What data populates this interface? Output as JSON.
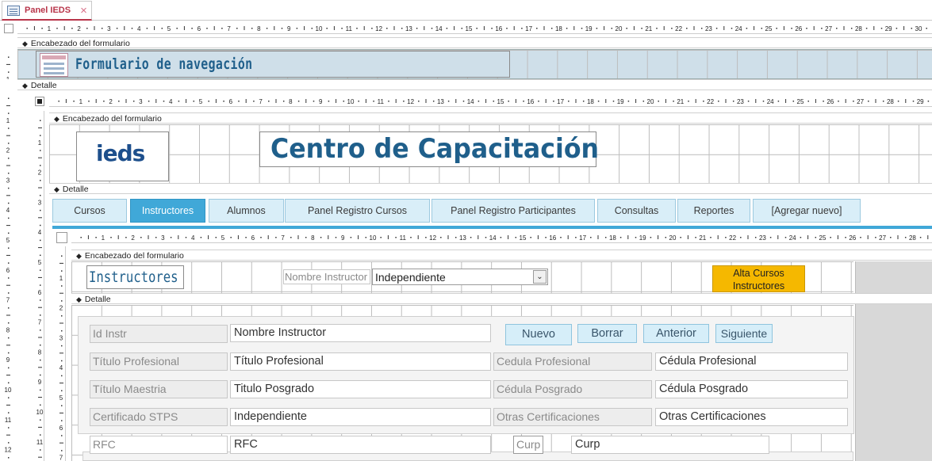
{
  "tab": {
    "title": "Panel IEDS",
    "close": "×"
  },
  "outer": {
    "header_section": "Encabezado del formulario",
    "title": "Formulario de navegación",
    "detail_section": "Detalle"
  },
  "nav_form": {
    "header_section": "Encabezado del formulario",
    "logo_text": "ieds",
    "title": "Centro de Capacitación",
    "detail_section": "Detalle",
    "tabs": [
      {
        "label": "Cursos"
      },
      {
        "label": "Instructores"
      },
      {
        "label": "Alumnos"
      },
      {
        "label": "Panel Registro Cursos"
      },
      {
        "label": "Panel Registro Participantes"
      },
      {
        "label": "Consultas"
      },
      {
        "label": "Reportes"
      },
      {
        "label": "[Agregar nuevo]"
      }
    ],
    "active_tab": "Instructores"
  },
  "sub_form": {
    "header_section": "Encabezado del formulario",
    "title": "Instructores",
    "filter_label": "Nombre Instructor",
    "filter_value": "Independiente",
    "alta_button": "Alta Cursos Instructores",
    "detail_section": "Detalle",
    "buttons": {
      "nuevo": "Nuevo",
      "borrar": "Borrar",
      "anterior": "Anterior",
      "siguiente": "Siguiente"
    },
    "fields": {
      "id_label": "Id Instr",
      "id_value": "Nombre Instructor",
      "titulo_label": "Título Profesional",
      "titulo_value": "Título Profesional",
      "cedula_label": "Cedula Profesional",
      "cedula_value": "Cédula Profesional",
      "maestria_label": "Título Maestria",
      "maestria_value": "Titulo Posgrado",
      "cedpos_label": "Cédula Posgrado",
      "cedpos_value": "Cédula Posgrado",
      "cert_label": "Certificado STPS",
      "cert_value": "Independiente",
      "otras_label": "Otras Certificaciones",
      "otras_value": "Otras Certificaciones",
      "rfc_label": "RFC",
      "rfc_value": "RFC",
      "curp_label": "Curp",
      "curp_value": "Curp"
    }
  },
  "colors": {
    "accent": "#40a8d8",
    "title_blue": "#1f5f8b",
    "alta_button": "#f5b800",
    "section_blue": "#cfdfe9"
  }
}
